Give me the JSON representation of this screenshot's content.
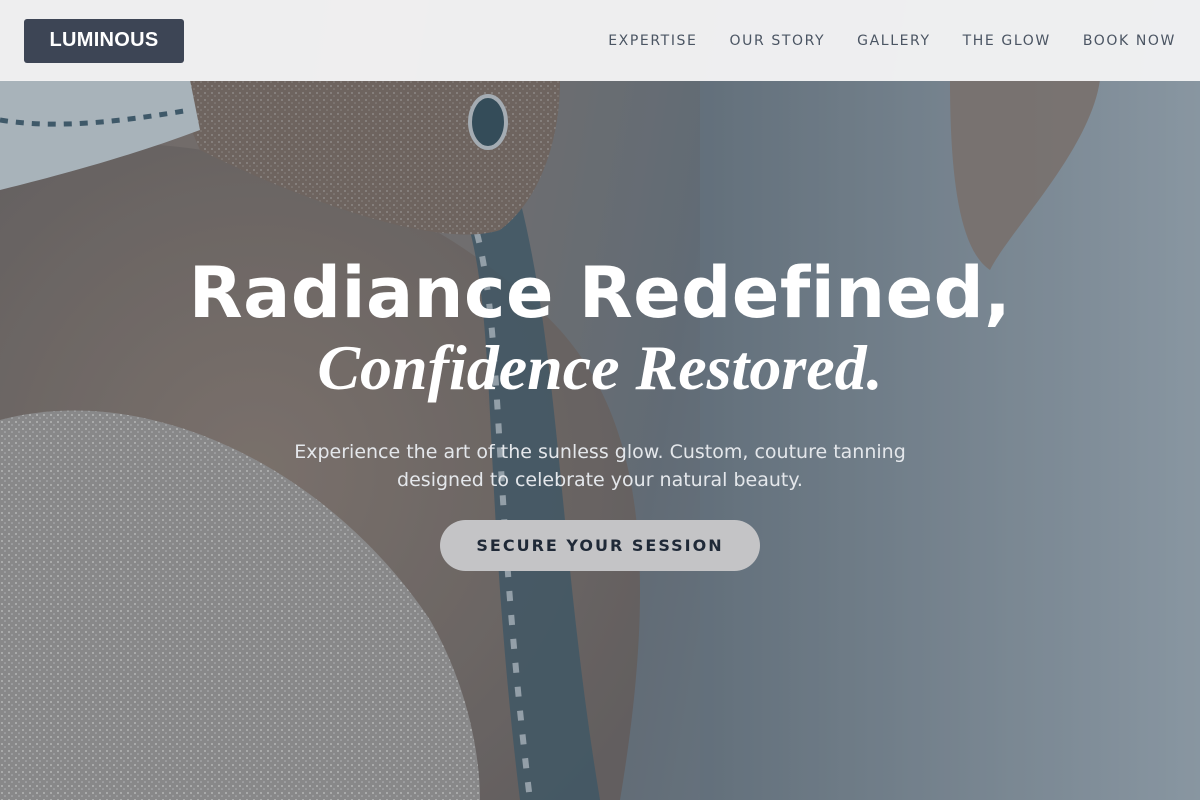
{
  "brand": {
    "logo_text": "LUMINOUS"
  },
  "nav": {
    "items": [
      {
        "label": "EXPERTISE"
      },
      {
        "label": "OUR STORY"
      },
      {
        "label": "GALLERY"
      },
      {
        "label": "THE GLOW"
      },
      {
        "label": "BOOK NOW"
      }
    ]
  },
  "hero": {
    "headline_line1": "Radiance Redefined,",
    "headline_line2": "Confidence Restored.",
    "subtext": "Experience the art of the sunless glow. Custom, couture tanning designed to celebrate your natural beauty.",
    "cta_label": "SECURE YOUR SESSION"
  },
  "colors": {
    "logo_bg": "#3d4555",
    "header_bg": "#f4f4f5",
    "nav_text": "#4b5563",
    "cta_bg": "#c4c4c6",
    "cta_text": "#1f2937",
    "headline": "#ffffff"
  }
}
